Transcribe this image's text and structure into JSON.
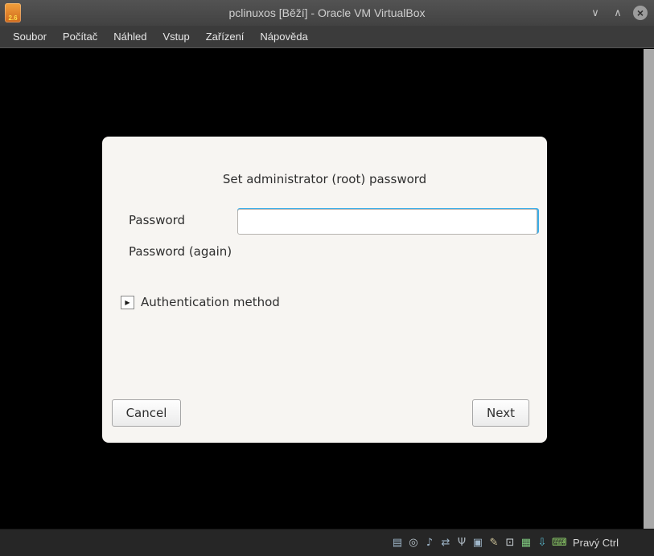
{
  "window": {
    "title": "pclinuxos [Běží] - Oracle VM VirtualBox",
    "icon_text": "2.6",
    "controls": {
      "minimize": "∨",
      "maximize": "∧",
      "close": "×"
    }
  },
  "menubar": {
    "items": [
      {
        "label": "Soubor"
      },
      {
        "label": "Počítač"
      },
      {
        "label": "Náhled"
      },
      {
        "label": "Vstup"
      },
      {
        "label": "Zařízení"
      },
      {
        "label": "Nápověda"
      }
    ]
  },
  "vm": {
    "dialog": {
      "title": "Set administrator (root) password",
      "password": {
        "label": "Password",
        "value": ""
      },
      "password_again": {
        "label": "Password (again)",
        "value": ""
      },
      "expander_arrow": "▶",
      "expander_label": "Authentication method",
      "cancel_label": "Cancel",
      "next_label": "Next"
    }
  },
  "statusbar": {
    "host_key_label": "Pravý Ctrl",
    "icons": [
      {
        "name": "hard-disks-icon",
        "glyph": "▤",
        "color": "#9fb6c9"
      },
      {
        "name": "optical-drives-icon",
        "glyph": "◎",
        "color": "#b9c4cc"
      },
      {
        "name": "audio-icon",
        "glyph": "♪",
        "color": "#9fb6c9"
      },
      {
        "name": "network-icon",
        "glyph": "⇄",
        "color": "#9fb6c9"
      },
      {
        "name": "usb-icon",
        "glyph": "Ψ",
        "color": "#aab4bd"
      },
      {
        "name": "shared-folders-icon",
        "glyph": "▣",
        "color": "#9fb6c9"
      },
      {
        "name": "recording-icon",
        "glyph": "✎",
        "color": "#cfc49a"
      },
      {
        "name": "display-icon",
        "glyph": "⊡",
        "color": "#d3d9de"
      },
      {
        "name": "features-icon",
        "glyph": "▦",
        "color": "#7fc97f"
      },
      {
        "name": "mouse-icon",
        "glyph": "⇩",
        "color": "#58b6c9"
      },
      {
        "name": "keyboard-icon",
        "glyph": "⌨",
        "color": "#8fd06a"
      }
    ]
  },
  "colors": {
    "focus_border": "#3daee9",
    "titlebar_bg": "#4a4a4a",
    "menubar_bg": "#3b3b3b",
    "statusbar_bg": "#262626",
    "dialog_bg": "#f7f5f2",
    "vm_screen_bg": "#000000"
  }
}
